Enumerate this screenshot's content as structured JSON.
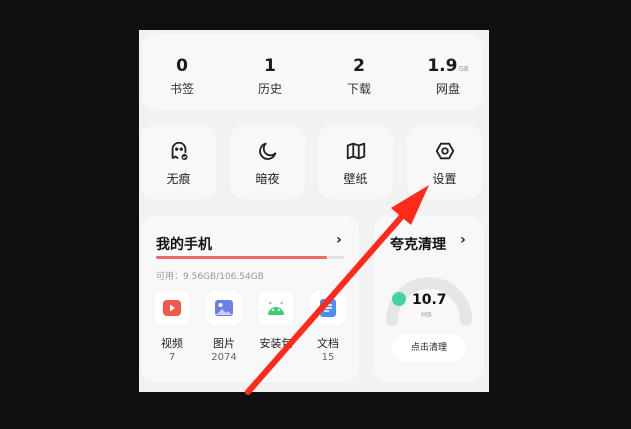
{
  "stats": [
    {
      "value": "0",
      "unit": "",
      "label": "书签"
    },
    {
      "value": "1",
      "unit": "",
      "label": "历史"
    },
    {
      "value": "2",
      "unit": "",
      "label": "下载"
    },
    {
      "value": "1.9",
      "unit": "GB",
      "label": "网盘"
    }
  ],
  "quick": [
    {
      "label": "无痕",
      "icon": "ghost-icon"
    },
    {
      "label": "暗夜",
      "icon": "moon-icon"
    },
    {
      "label": "壁纸",
      "icon": "map-icon"
    },
    {
      "label": "设置",
      "icon": "gear-icon"
    }
  ],
  "phone": {
    "title": "我的手机",
    "available": "可用：9.56GB/106.54GB",
    "used_fraction": 0.91,
    "apps": [
      {
        "name": "视频",
        "count": "7",
        "icon": "video-icon",
        "color": "#f05a4a"
      },
      {
        "name": "图片",
        "count": "2074",
        "icon": "image-icon",
        "color": "#6b7ee6"
      },
      {
        "name": "安装包",
        "count": "",
        "icon": "android-icon",
        "color": "#3ccf6e"
      },
      {
        "name": "文档",
        "count": "15",
        "icon": "document-icon",
        "color": "#4a8ff0"
      }
    ]
  },
  "clean": {
    "title": "夸克清理",
    "value": "10.7",
    "unit": "MB",
    "button": "点击清理",
    "accent": "#41d6a0"
  },
  "annotation": {
    "arrow_color": "#ff2a1a"
  }
}
